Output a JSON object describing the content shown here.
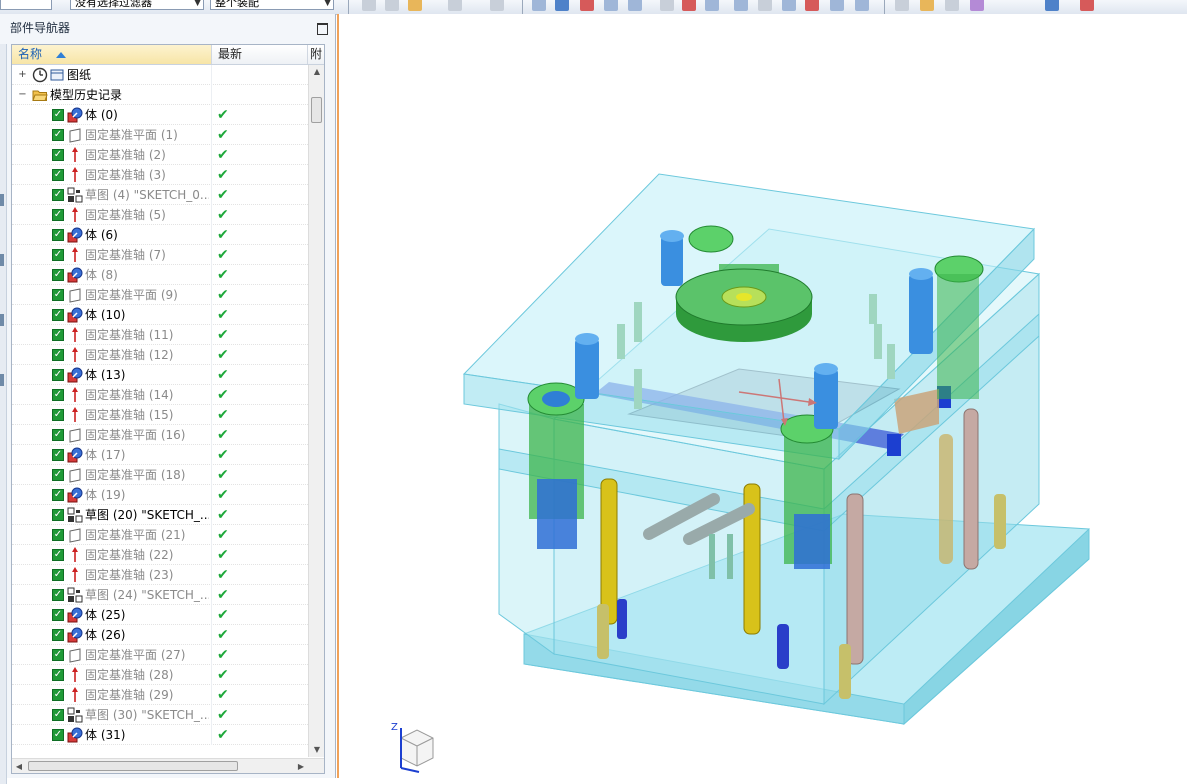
{
  "toolbar": {
    "filter_combo": "没有选择过滤器",
    "assembly_combo": "整个装配"
  },
  "navigator": {
    "title": "部件导航器",
    "columns": {
      "name": "名称",
      "latest": "最新",
      "extra": "附"
    }
  },
  "tree": {
    "root_nodes": [
      {
        "label": "图纸",
        "icon": "drawing-clock-icon",
        "expander": "+"
      },
      {
        "label": "模型历史记录",
        "icon": "folder-open-icon",
        "expander": "−"
      }
    ],
    "rows": [
      {
        "label": "体 (0)",
        "type": "body",
        "active": true
      },
      {
        "label": "固定基准平面 (1)",
        "type": "plane",
        "active": false
      },
      {
        "label": "固定基准轴 (2)",
        "type": "axis",
        "active": false
      },
      {
        "label": "固定基准轴 (3)",
        "type": "axis",
        "active": false
      },
      {
        "label": "草图 (4) \"SKETCH_0...",
        "type": "sketch",
        "active": false
      },
      {
        "label": "固定基准轴 (5)",
        "type": "axis",
        "active": false
      },
      {
        "label": "体 (6)",
        "type": "body",
        "active": true
      },
      {
        "label": "固定基准轴 (7)",
        "type": "axis",
        "active": false
      },
      {
        "label": "体 (8)",
        "type": "body",
        "active": false
      },
      {
        "label": "固定基准平面 (9)",
        "type": "plane",
        "active": false
      },
      {
        "label": "体 (10)",
        "type": "body",
        "active": true
      },
      {
        "label": "固定基准轴 (11)",
        "type": "axis",
        "active": false
      },
      {
        "label": "固定基准轴 (12)",
        "type": "axis",
        "active": false
      },
      {
        "label": "体 (13)",
        "type": "body",
        "active": true
      },
      {
        "label": "固定基准轴 (14)",
        "type": "axis",
        "active": false
      },
      {
        "label": "固定基准轴 (15)",
        "type": "axis",
        "active": false
      },
      {
        "label": "固定基准平面 (16)",
        "type": "plane",
        "active": false
      },
      {
        "label": "体 (17)",
        "type": "body",
        "active": false
      },
      {
        "label": "固定基准平面 (18)",
        "type": "plane",
        "active": false
      },
      {
        "label": "体 (19)",
        "type": "body",
        "active": false
      },
      {
        "label": "草图 (20) \"SKETCH_...",
        "type": "sketch",
        "active": true
      },
      {
        "label": "固定基准平面 (21)",
        "type": "plane",
        "active": false
      },
      {
        "label": "固定基准轴 (22)",
        "type": "axis",
        "active": false
      },
      {
        "label": "固定基准轴 (23)",
        "type": "axis",
        "active": false
      },
      {
        "label": "草图 (24) \"SKETCH_...",
        "type": "sketch",
        "active": false
      },
      {
        "label": "体 (25)",
        "type": "body",
        "active": true
      },
      {
        "label": "体 (26)",
        "type": "body",
        "active": true
      },
      {
        "label": "固定基准平面 (27)",
        "type": "plane",
        "active": false
      },
      {
        "label": "固定基准轴 (28)",
        "type": "axis",
        "active": false
      },
      {
        "label": "固定基准轴 (29)",
        "type": "axis",
        "active": false
      },
      {
        "label": "草图 (30) \"SKETCH_...",
        "type": "sketch",
        "active": false
      },
      {
        "label": "体 (31)",
        "type": "body",
        "active": true
      }
    ]
  },
  "viewport": {
    "triad_axis_label": "Z",
    "colors": {
      "plate": "#9fe6f2",
      "plate_edge": "#5cc6dc",
      "green_ring": "#3cb44b",
      "bolt_blue": "#2f7fd6",
      "guide_yellow": "#d8c21a",
      "accent_border": "#f0a25a"
    }
  }
}
